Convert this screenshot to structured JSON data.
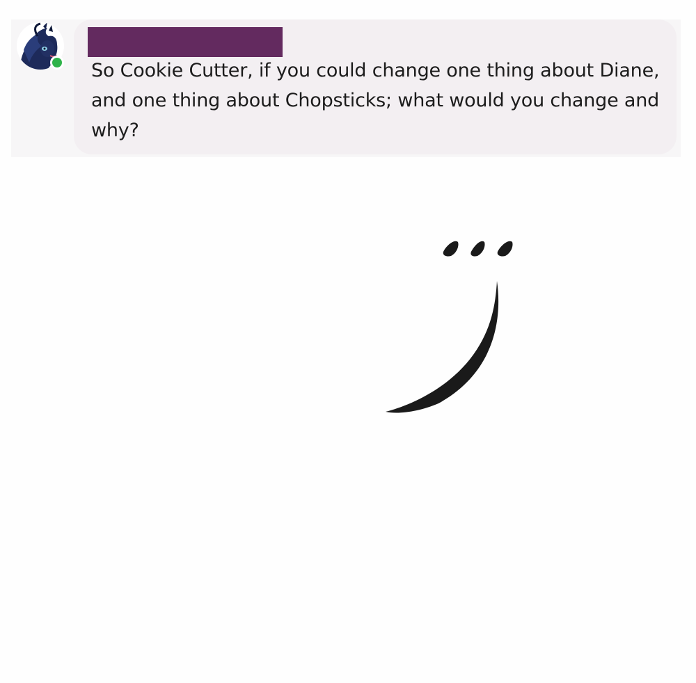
{
  "message": {
    "sender_name": "",
    "text": "So Cookie Cutter, if you could change one thing about Diane, and one thing about Chopsticks; what would you change and why?",
    "presence": "online"
  },
  "avatar": {
    "icon": "pony-avatar-icon"
  },
  "overlay": {
    "icon": "brushstroke-face-icon",
    "description_glyph": "..."
  },
  "colors": {
    "bubble": "#f3eff2",
    "redaction": "#632a5f",
    "presence": "#2fb34a",
    "text": "#1c1c1c",
    "stroke": "#1a1a1a"
  }
}
